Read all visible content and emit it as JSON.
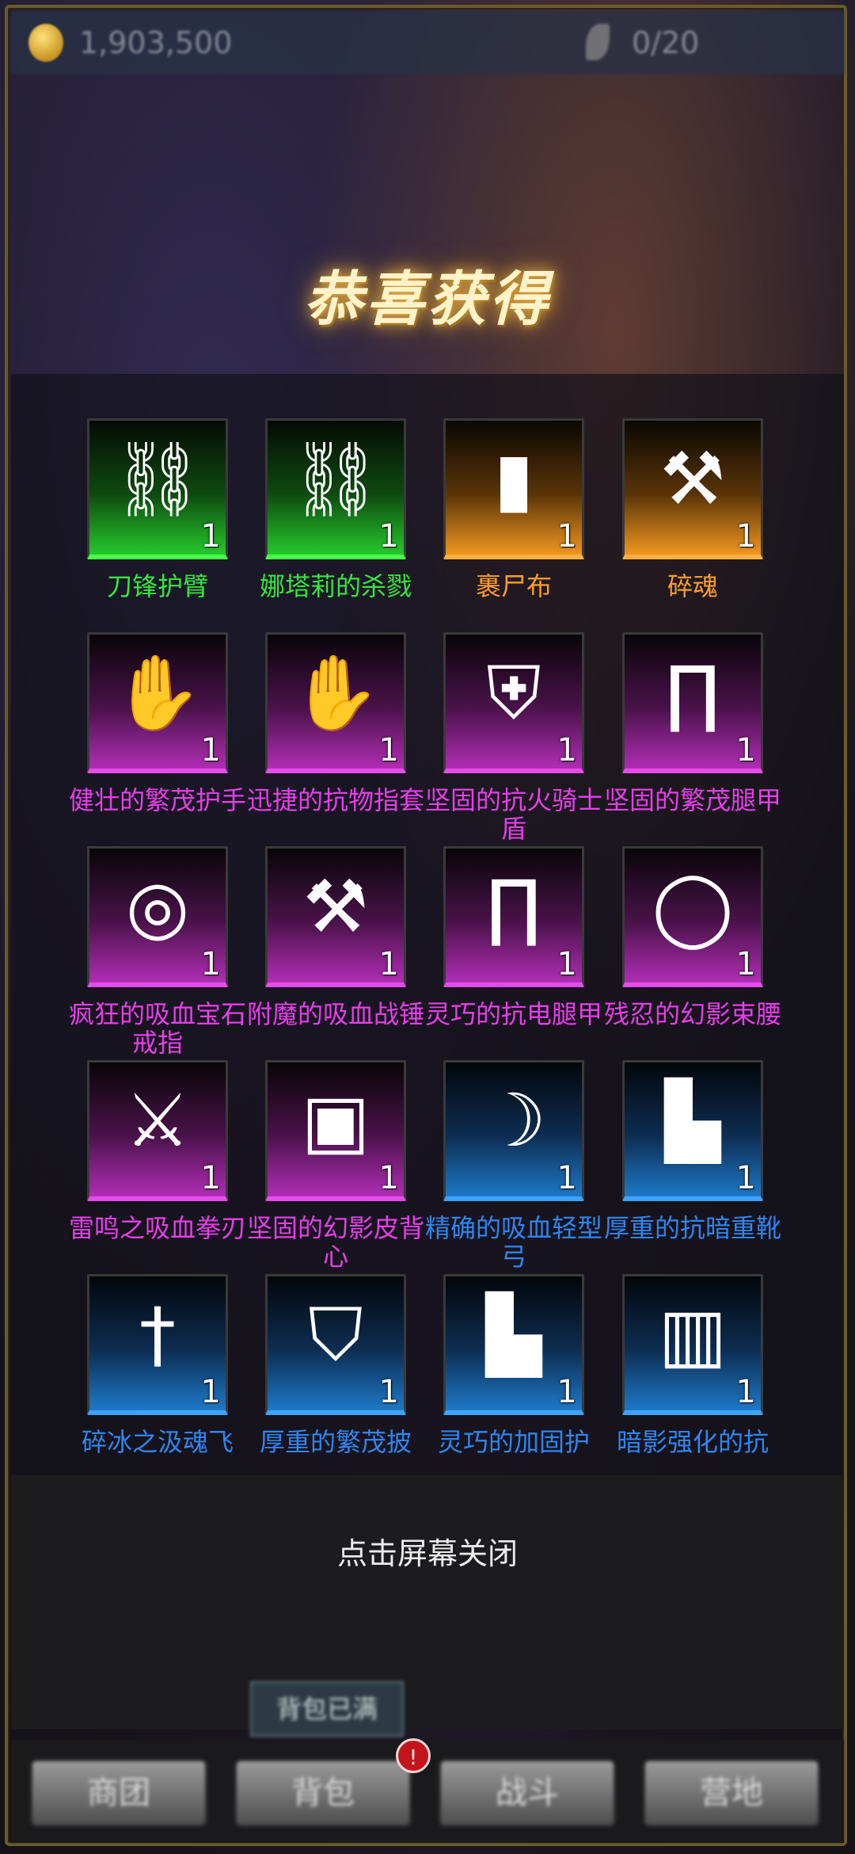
{
  "header": {
    "gold": "1,903,500",
    "stamina": "0/20"
  },
  "title": "恭喜获得",
  "items": [
    {
      "name": "刀锋护臂",
      "count": "1",
      "quality": "green",
      "icon": "bracer-icon",
      "glyph": "⛓"
    },
    {
      "name": "娜塔莉的杀戮",
      "count": "1",
      "quality": "green",
      "icon": "spiked-bracer-icon",
      "glyph": "⛓"
    },
    {
      "name": "裹尸布",
      "count": "1",
      "quality": "orange",
      "icon": "shroud-icon",
      "glyph": "▮"
    },
    {
      "name": "碎魂",
      "count": "1",
      "quality": "orange",
      "icon": "mace-icon",
      "glyph": "⚒"
    },
    {
      "name": "健壮的繁茂护手",
      "count": "1",
      "quality": "purple",
      "icon": "gauntlets-icon",
      "glyph": "✋"
    },
    {
      "name": "迅捷的抗物指套",
      "count": "1",
      "quality": "purple",
      "icon": "gloves-icon",
      "glyph": "✋"
    },
    {
      "name": "坚固的抗火骑士盾",
      "count": "1",
      "quality": "purple",
      "icon": "shield-icon",
      "glyph": "⛨"
    },
    {
      "name": "坚固的繁茂腿甲",
      "count": "1",
      "quality": "purple",
      "icon": "leg-armor-icon",
      "glyph": "∏"
    },
    {
      "name": "疯狂的吸血宝石戒指",
      "count": "1",
      "quality": "purple",
      "icon": "ring-icon",
      "glyph": "◎"
    },
    {
      "name": "附魔的吸血战锤",
      "count": "1",
      "quality": "purple",
      "icon": "hammer-icon",
      "glyph": "⚒"
    },
    {
      "name": "灵巧的抗电腿甲",
      "count": "1",
      "quality": "purple",
      "icon": "leg-armor-icon",
      "glyph": "∏"
    },
    {
      "name": "残忍的幻影束腰",
      "count": "1",
      "quality": "purple",
      "icon": "belt-icon",
      "glyph": "◯"
    },
    {
      "name": "雷鸣之吸血拳刃",
      "count": "1",
      "quality": "purple",
      "icon": "fist-blade-icon",
      "glyph": "⚔"
    },
    {
      "name": "坚固的幻影皮背心",
      "count": "1",
      "quality": "purple",
      "icon": "leather-vest-icon",
      "glyph": "▣"
    },
    {
      "name": "精确的吸血轻型弓",
      "count": "1",
      "quality": "blue",
      "icon": "bow-icon",
      "glyph": "☽"
    },
    {
      "name": "厚重的抗暗重靴",
      "count": "1",
      "quality": "blue",
      "icon": "boots-icon",
      "glyph": "▙"
    },
    {
      "name": "碎冰之汲魂飞",
      "count": "1",
      "quality": "blue",
      "icon": "dagger-icon",
      "glyph": "†"
    },
    {
      "name": "厚重的繁茂披",
      "count": "1",
      "quality": "blue",
      "icon": "cloak-icon",
      "glyph": "⛉"
    },
    {
      "name": "灵巧的加固护",
      "count": "1",
      "quality": "blue",
      "icon": "greaves-icon",
      "glyph": "▙"
    },
    {
      "name": "暗影强化的抗",
      "count": "1",
      "quality": "blue",
      "icon": "vambrace-icon",
      "glyph": "▥"
    }
  ],
  "close_hint": "点击屏幕关闭",
  "bag_tip": "背包已满",
  "tabs": [
    "商团",
    "背包",
    "战斗",
    "营地"
  ],
  "badge": "!",
  "colors": {
    "green": "#34e83a",
    "orange": "#ff9d2a",
    "purple": "#e63fe9",
    "blue": "#2f86f0",
    "title_glow": "#e6b04a"
  }
}
